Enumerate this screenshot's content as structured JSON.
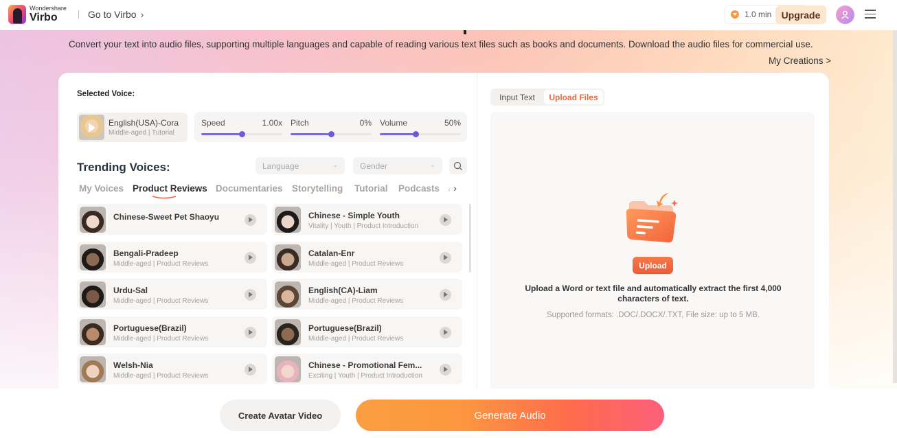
{
  "header": {
    "brand": "Wondershare",
    "product": "Virbo",
    "goto_label": "Go to Virbo",
    "credits": "1.0 min",
    "upgrade_label": "Upgrade"
  },
  "hero": {
    "subtitle": "Convert your text into audio files, supporting multiple languages and capable of reading various text files such as books and documents. Download the audio files for commercial use.",
    "my_creations": "My Creations >"
  },
  "selected_voice": {
    "label": "Selected Voice:",
    "name": "English(USA)-Cora",
    "tags": "Middle-aged | Tutorial"
  },
  "sliders": [
    {
      "label": "Speed",
      "value": "1.00x",
      "fraction": 0.5
    },
    {
      "label": "Pitch",
      "value": "0%",
      "fraction": 0.5
    },
    {
      "label": "Volume",
      "value": "50%",
      "fraction": 0.44
    }
  ],
  "trending": {
    "title": "Trending Voices:",
    "language_placeholder": "Language",
    "gender_placeholder": "Gender",
    "tabs": [
      "My Voices",
      "Product Reviews",
      "Documentaries",
      "Storytelling",
      "Tutorial",
      "Podcasts",
      "A"
    ],
    "active_tab": "Product Reviews",
    "voices": [
      {
        "name": "Chinese-Sweet Pet Shaoyu",
        "tags": ""
      },
      {
        "name": "Chinese - Simple Youth",
        "tags": "Vitality | Youth | Product Introduction"
      },
      {
        "name": "Bengali-Pradeep",
        "tags": "Middle-aged | Product Reviews"
      },
      {
        "name": "Catalan-Enr",
        "tags": "Middle-aged | Product Reviews"
      },
      {
        "name": "Urdu-Sal",
        "tags": "Middle-aged | Product Reviews"
      },
      {
        "name": "English(CA)-Liam",
        "tags": "Middle-aged | Product Reviews"
      },
      {
        "name": "Portuguese(Brazil)",
        "tags": "Middle-aged | Product Reviews"
      },
      {
        "name": "Portuguese(Brazil)",
        "tags": "Middle-aged | Product Reviews"
      },
      {
        "name": "Welsh-Nia",
        "tags": "Middle-aged | Product Reviews"
      },
      {
        "name": "Chinese - Promotional Fem...",
        "tags": "Exciting | Youth | Product Introduction"
      }
    ]
  },
  "right_panel": {
    "tab_input": "Input Text",
    "tab_upload": "Upload Files",
    "active_tab": "Upload Files",
    "upload_label": "Upload",
    "description": "Upload a Word or text file and automatically extract the first 4,000 characters of text.",
    "formats": "Supported formats: .DOC/.DOCX/.TXT, File size: up to 5 MB."
  },
  "actions": {
    "create_avatar_video": "Create Avatar Video",
    "generate_audio": "Generate Audio"
  },
  "colors": {
    "accent": "#ee6a45",
    "slider": "#6d5bd6",
    "upgrade_bg": "#fde6cf"
  }
}
